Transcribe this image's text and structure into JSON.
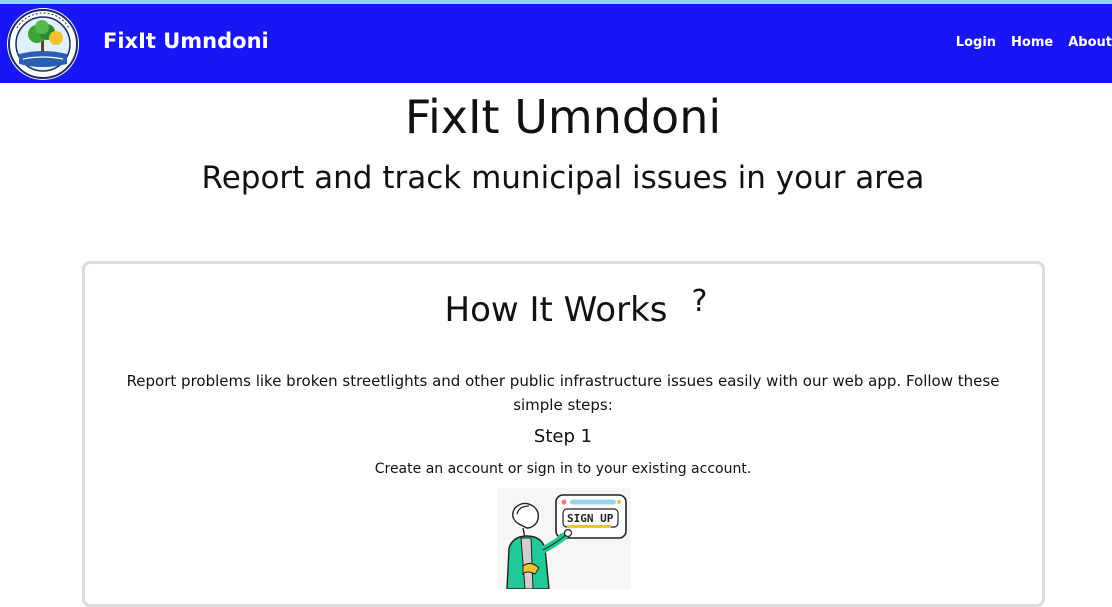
{
  "navbar": {
    "brand": "FixIt Umndoni",
    "links": [
      "Login",
      "Home",
      "About"
    ],
    "bg_color": "#1a15f5",
    "logo_icon": "municipality-seal"
  },
  "hero": {
    "title": "FixIt Umndoni",
    "subtitle": "Report and track municipal issues in your area"
  },
  "how_it_works": {
    "title": "How It Works",
    "title_icon_glyph": "?",
    "intro": "Report problems like broken streetlights and other public infrastructure issues easily with our web app. Follow these simple steps:",
    "step_title": "Step 1",
    "step_desc": "Create an account or sign in to your existing account.",
    "illustration_text": "SIGN UP",
    "illustration_icon": "person-pointing-signup-illustration"
  }
}
